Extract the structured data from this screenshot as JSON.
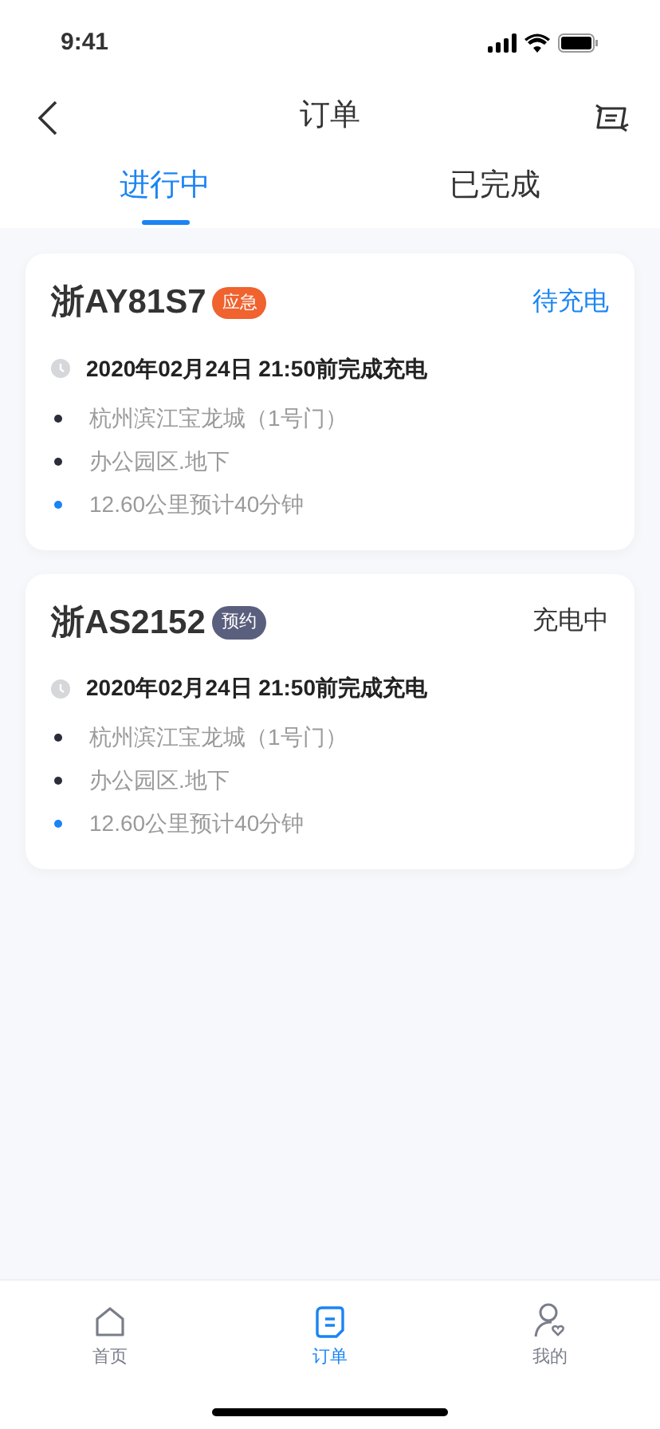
{
  "status_bar": {
    "time": "9:41"
  },
  "nav": {
    "title": "订单"
  },
  "tabs": [
    {
      "label": "进行中",
      "selected": true
    },
    {
      "label": "已完成",
      "selected": false
    }
  ],
  "orders": [
    {
      "plate": "浙AY81S7",
      "badge": {
        "label": "应急",
        "color": "#f0622e"
      },
      "status": {
        "label": "待充电",
        "color": "#1a84f4"
      },
      "deadline": "2020年02月24日 21:50前完成充电",
      "lines": [
        {
          "text": "杭州滨江宝龙城（1号门）",
          "color": "#2b2d3a"
        },
        {
          "text": "办公园区.地下",
          "color": "#2b2d3a"
        },
        {
          "text": "12.60公里预计40分钟",
          "color": "#1a84f4"
        }
      ]
    },
    {
      "plate": "浙AS2152",
      "badge": {
        "label": "预约",
        "color": "#5b5f7e"
      },
      "status": {
        "label": "充电中",
        "color": "#333333"
      },
      "deadline": "2020年02月24日 21:50前完成充电",
      "lines": [
        {
          "text": "杭州滨江宝龙城（1号门）",
          "color": "#2b2d3a"
        },
        {
          "text": "办公园区.地下",
          "color": "#2b2d3a"
        },
        {
          "text": "12.60公里预计40分钟",
          "color": "#1a84f4"
        }
      ]
    }
  ],
  "tab_bar": [
    {
      "label": "首页",
      "kind": "home",
      "selected": false
    },
    {
      "label": "订单",
      "kind": "orders",
      "selected": true
    },
    {
      "label": "我的",
      "kind": "profile",
      "selected": false
    }
  ]
}
